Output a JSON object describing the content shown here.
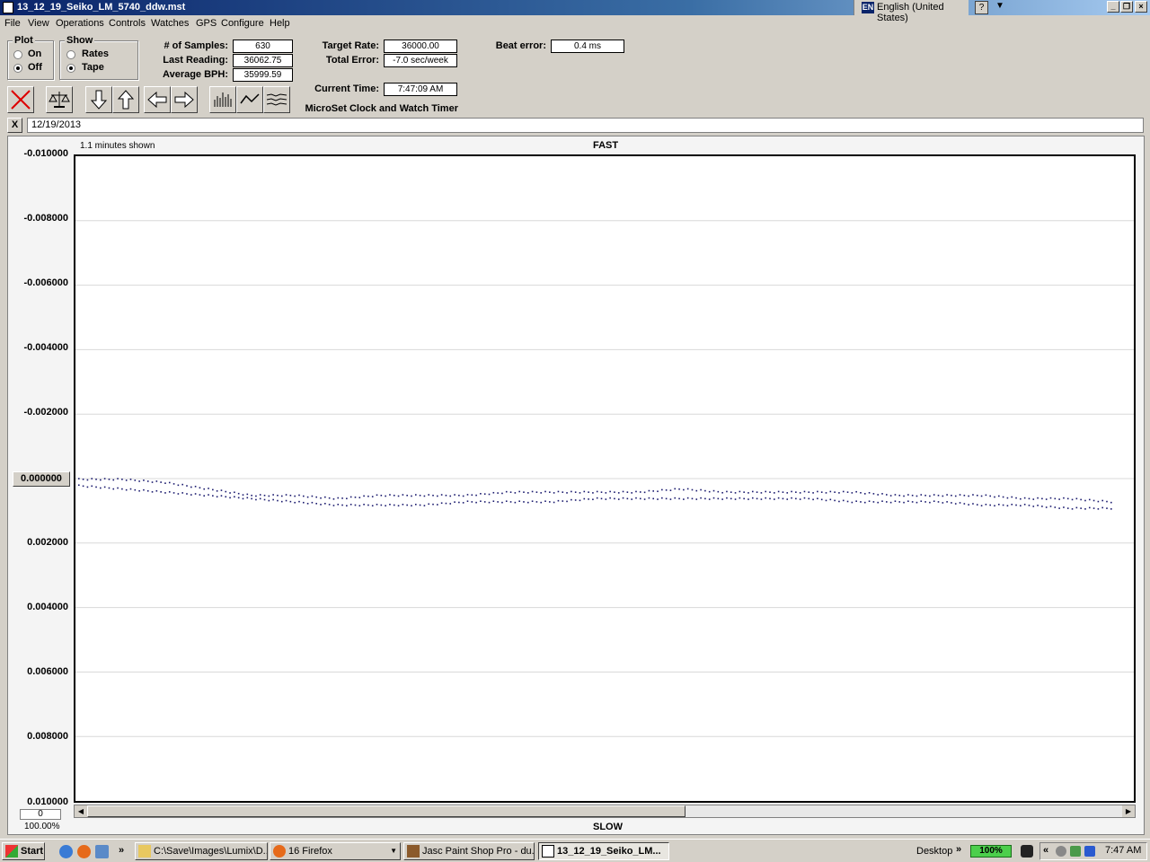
{
  "window": {
    "title": "13_12_19_Seiko_LM_5740_ddw.mst"
  },
  "language": {
    "badge": "EN",
    "label": "English (United States)"
  },
  "titlebar_help": "?",
  "menu": [
    "File",
    "View",
    "Operations",
    "Controls",
    "Watches",
    "GPS",
    "Configure",
    "Help"
  ],
  "plot_group": {
    "label": "Plot",
    "options": [
      "On",
      "Off"
    ],
    "selected": "Off"
  },
  "show_group": {
    "label": "Show",
    "options": [
      "Rates",
      "Tape"
    ],
    "selected": "Tape"
  },
  "stats": {
    "samples_label": "# of Samples:",
    "samples": "630",
    "last_reading_label": "Last Reading:",
    "last_reading": "36062.75",
    "avg_bph_label": "Average BPH:",
    "avg_bph": "35999.59",
    "target_rate_label": "Target Rate:",
    "target_rate": "36000.00",
    "total_error_label": "Total Error:",
    "total_error": "-7.0 sec/week",
    "current_time_label": "Current Time:",
    "current_time": "7:47:09 AM",
    "beat_error_label": "Beat error:",
    "beat_error": "0.4 ms"
  },
  "app_name": "MicroSet Clock and Watch Timer",
  "date_bar": {
    "close": "X",
    "date": "12/19/2013"
  },
  "chart_data": {
    "type": "scatter",
    "title_top": "FAST",
    "title_bottom": "SLOW",
    "note": "1.1 minutes shown",
    "y_ticks": [
      "-0.010000",
      "-0.008000",
      "-0.006000",
      "-0.004000",
      "-0.002000",
      "0.000000",
      "0.002000",
      "0.004000",
      "0.006000",
      "0.008000",
      "0.010000"
    ],
    "ylim": [
      -0.01,
      0.01
    ],
    "y_inverted": true,
    "series": [
      {
        "values": [
          0.0,
          0.0,
          0.0001,
          0.0003,
          0.0005,
          0.0005,
          0.0006,
          0.0005,
          0.0005,
          0.0005,
          0.0004,
          0.0004,
          0.0004,
          0.0004,
          0.0003,
          0.0004,
          0.0004,
          0.0004,
          0.0004,
          0.0005,
          0.0005,
          0.0005,
          0.0006,
          0.0006,
          0.0007
        ]
      },
      {
        "values": [
          0.0002,
          0.0003,
          0.0004,
          0.0005,
          0.0006,
          0.0007,
          0.0008,
          0.0008,
          0.0008,
          0.0007,
          0.0007,
          0.0007,
          0.0006,
          0.0006,
          0.0006,
          0.0006,
          0.0006,
          0.0006,
          0.0007,
          0.0007,
          0.0007,
          0.0008,
          0.0008,
          0.0009,
          0.0009
        ]
      }
    ],
    "color": "#1a1a6e"
  },
  "zero_button": "0.000000",
  "zoom_value": "0",
  "zoom_percent": "100.00%",
  "taskbar": {
    "start": "Start",
    "more": "»",
    "items": [
      {
        "label": "C:\\Save\\Images\\Lumix\\D..."
      },
      {
        "label": "16 Firefox"
      },
      {
        "label": "Jasc Paint Shop Pro - du..."
      },
      {
        "label": "13_12_19_Seiko_LM..."
      }
    ],
    "desktop": "Desktop",
    "desktop_more": "»",
    "battery": "100%",
    "tray_more": "«",
    "clock": "7:47 AM"
  }
}
